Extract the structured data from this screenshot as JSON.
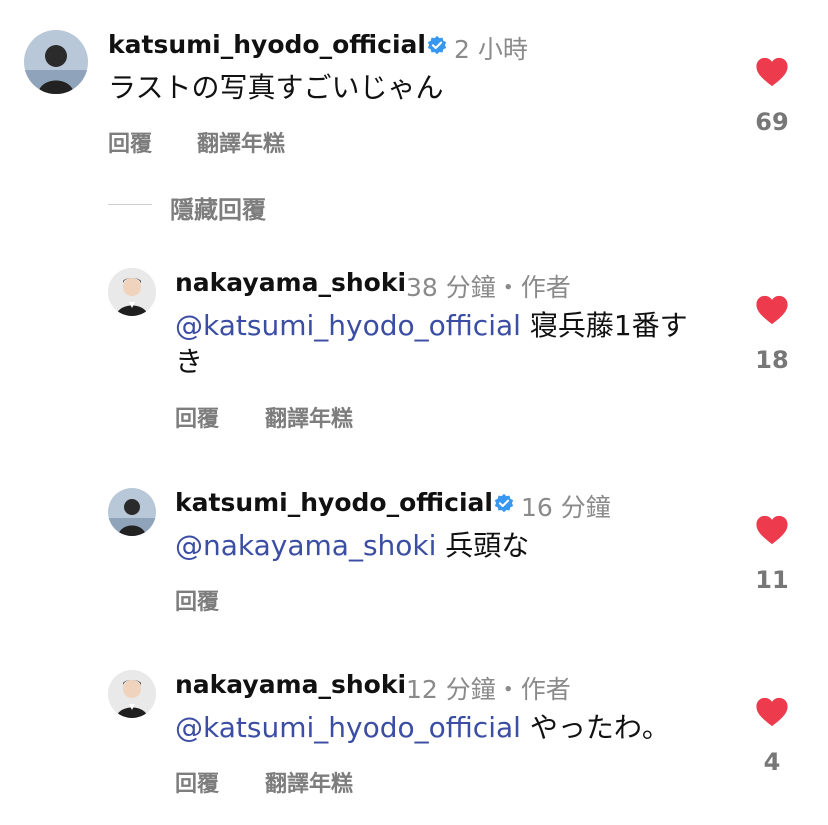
{
  "labels": {
    "reply": "回覆",
    "translate": "翻譯年糕",
    "hide_replies": "隱藏回覆"
  },
  "colors": {
    "heart": "#ed3a4d",
    "mention": "#3b4ea3",
    "verified": "#3897f0"
  },
  "comments": [
    {
      "username": "katsumi_hyodo_official",
      "verified": true,
      "time": "2 小時",
      "mention": "",
      "text": "ラストの写真すごいじゃん",
      "likes": "69",
      "avatar_icon": "avatar-person-icon"
    },
    {
      "username": "nakayama_shoki",
      "verified": false,
      "time": "38 分鐘・作者",
      "mention": "@katsumi_hyodo_official",
      "text": " 寝兵藤1番すき",
      "likes": "18",
      "avatar_icon": "avatar-person-icon"
    },
    {
      "username": "katsumi_hyodo_official",
      "verified": true,
      "time": "16 分鐘",
      "mention": "@nakayama_shoki",
      "text": " 兵頭な",
      "likes": "11",
      "avatar_icon": "avatar-person-icon"
    },
    {
      "username": "nakayama_shoki",
      "verified": false,
      "time": "12 分鐘・作者",
      "mention": "@katsumi_hyodo_official",
      "text": " やったわ。",
      "likes": "4",
      "avatar_icon": "avatar-person-icon"
    }
  ]
}
